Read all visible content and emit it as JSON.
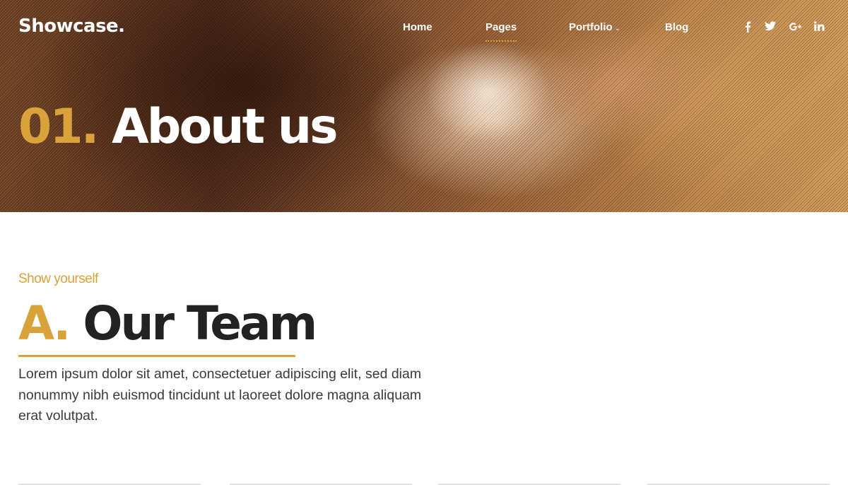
{
  "header": {
    "logo": "Showcase.",
    "nav": [
      {
        "label": "Home"
      },
      {
        "label": "Pages",
        "active": true
      },
      {
        "label": "Portfolio",
        "has_dropdown": true
      },
      {
        "label": "Blog"
      }
    ],
    "social": [
      {
        "icon": "facebook-icon",
        "glyph": "f"
      },
      {
        "icon": "twitter-icon",
        "glyph": "🐦"
      },
      {
        "icon": "google-plus-icon",
        "glyph": "g+"
      },
      {
        "icon": "linkedin-icon",
        "glyph": "in"
      }
    ]
  },
  "hero": {
    "number": "01.",
    "title": "About us"
  },
  "section": {
    "eyebrow": "Show yourself",
    "letter": "A.",
    "title": "Our Team",
    "body": "Lorem ipsum dolor sit amet, consectetuer adipiscing elit, sed diam nonummy nibh euismod tincidunt ut laoreet dolore magna aliquam erat volutpat."
  },
  "colors": {
    "accent": "#d9a23a",
    "heading": "#222222",
    "text": "#3a3a3a"
  }
}
